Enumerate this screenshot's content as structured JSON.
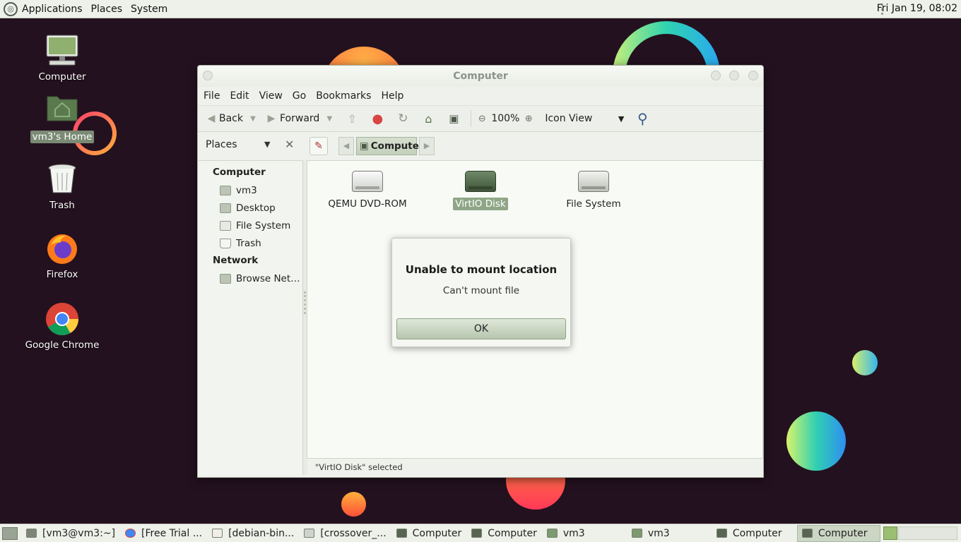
{
  "top_panel": {
    "menus": [
      "Applications",
      "Places",
      "System"
    ],
    "clock": "Fri Jan 19, 08:02"
  },
  "desktop_icons": [
    {
      "label": "Computer",
      "icon": "computer-icon"
    },
    {
      "label": "vm3's Home",
      "icon": "home-folder-icon",
      "selected": true
    },
    {
      "label": "Trash",
      "icon": "trash-icon"
    },
    {
      "label": "Firefox",
      "icon": "firefox-icon"
    },
    {
      "label": "Google Chrome",
      "icon": "chrome-icon"
    }
  ],
  "window": {
    "title": "Computer",
    "menus": [
      "File",
      "Edit",
      "View",
      "Go",
      "Bookmarks",
      "Help"
    ],
    "toolbar": {
      "back": "Back",
      "forward": "Forward",
      "zoom": "100%",
      "view_mode": "Icon View"
    },
    "side_pane_mode": "Places",
    "breadcrumb": "Computer",
    "sidebar": {
      "computer_heading": "Computer",
      "computer_items": [
        "vm3",
        "Desktop",
        "File System",
        "Trash"
      ],
      "network_heading": "Network",
      "network_items": [
        "Browse Net…"
      ]
    },
    "files": [
      {
        "label": "QEMU DVD-ROM",
        "icon": "optical-drive-icon"
      },
      {
        "label": "VirtIO Disk",
        "icon": "hard-disk-icon",
        "selected": true
      },
      {
        "label": "File System",
        "icon": "filesystem-drive-icon"
      }
    ],
    "status": "\"VirtIO Disk\" selected"
  },
  "dialog": {
    "title": "Unable to mount location",
    "message": "Can't mount file",
    "ok": "OK"
  },
  "taskbar": {
    "tasks": [
      {
        "label": "[vm3@vm3:~]",
        "icon": "terminal-icon"
      },
      {
        "label": "[Free Trial ...",
        "icon": "chrome-icon"
      },
      {
        "label": "[debian-bin...",
        "icon": "text-editor-icon"
      },
      {
        "label": "[crossover_...",
        "icon": "package-icon"
      },
      {
        "label": "Computer",
        "icon": "computer-icon"
      },
      {
        "label": "Computer",
        "icon": "computer-icon"
      },
      {
        "label": "vm3",
        "icon": "folder-icon"
      },
      {
        "label": "vm3",
        "icon": "folder-icon"
      },
      {
        "label": "Computer",
        "icon": "computer-icon"
      },
      {
        "label": "Computer",
        "icon": "computer-icon",
        "active": true
      }
    ]
  },
  "colors": {
    "desktop_bg": "#24111f",
    "panel_bg": "#eef1ea",
    "selection": "#8ea686"
  }
}
